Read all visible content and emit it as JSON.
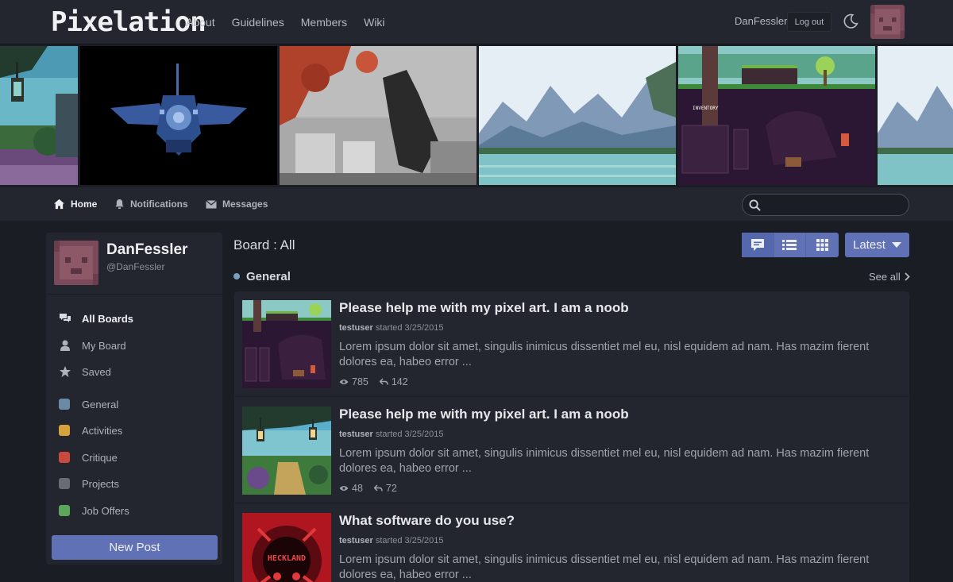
{
  "header": {
    "logo": "Pixelation",
    "nav": [
      "About",
      "Guidelines",
      "Members",
      "Wiki"
    ],
    "username": "DanFessler",
    "logout_label": "Log out"
  },
  "subnav": {
    "home": "Home",
    "notifications": "Notifications",
    "messages": "Messages",
    "search_value": ""
  },
  "sidebar": {
    "name": "DanFessler",
    "handle": "@DanFessler",
    "nav": [
      "All Boards",
      "My Board",
      "Saved"
    ],
    "boards": [
      {
        "label": "General",
        "color": "#6b8aa5"
      },
      {
        "label": "Activities",
        "color": "#d6a23d"
      },
      {
        "label": "Critique",
        "color": "#c9483f"
      },
      {
        "label": "Projects",
        "color": "#6a6c73"
      },
      {
        "label": "Job Offers",
        "color": "#5ea55c"
      }
    ],
    "new_post_label": "New Post"
  },
  "main": {
    "board_title": "Board : All",
    "sort_label": "Latest",
    "section_title": "General",
    "see_all_label": "See all",
    "posts": [
      {
        "title": "Please help me with my pixel art. I am a noob",
        "author": "testuser",
        "started": "started 3/25/2015",
        "excerpt": "Lorem ipsum dolor sit amet, singulis inimicus dissentiet mel eu, nisl equidem ad nam. Has mazim fierent dolores ea, habeo error ...",
        "views": "785",
        "replies": "142"
      },
      {
        "title": "Please help me with my pixel art. I am a noob",
        "author": "testuser",
        "started": "started 3/25/2015",
        "excerpt": "Lorem ipsum dolor sit amet, singulis inimicus dissentiet mel eu, nisl equidem ad nam. Has mazim fierent dolores ea, habeo error ...",
        "views": "48",
        "replies": "72"
      },
      {
        "title": "What software do you use?",
        "author": "testuser",
        "started": "started 3/25/2015",
        "excerpt": "Lorem ipsum dolor sit amet, singulis inimicus dissentiet mel eu, nisl equidem ad nam. Has mazim fierent dolores ea, habeo error ...",
        "views": "",
        "replies": ""
      }
    ]
  },
  "thumb_text": {
    "inventory": "INVENTORY",
    "heckland": "HECKLAND"
  }
}
